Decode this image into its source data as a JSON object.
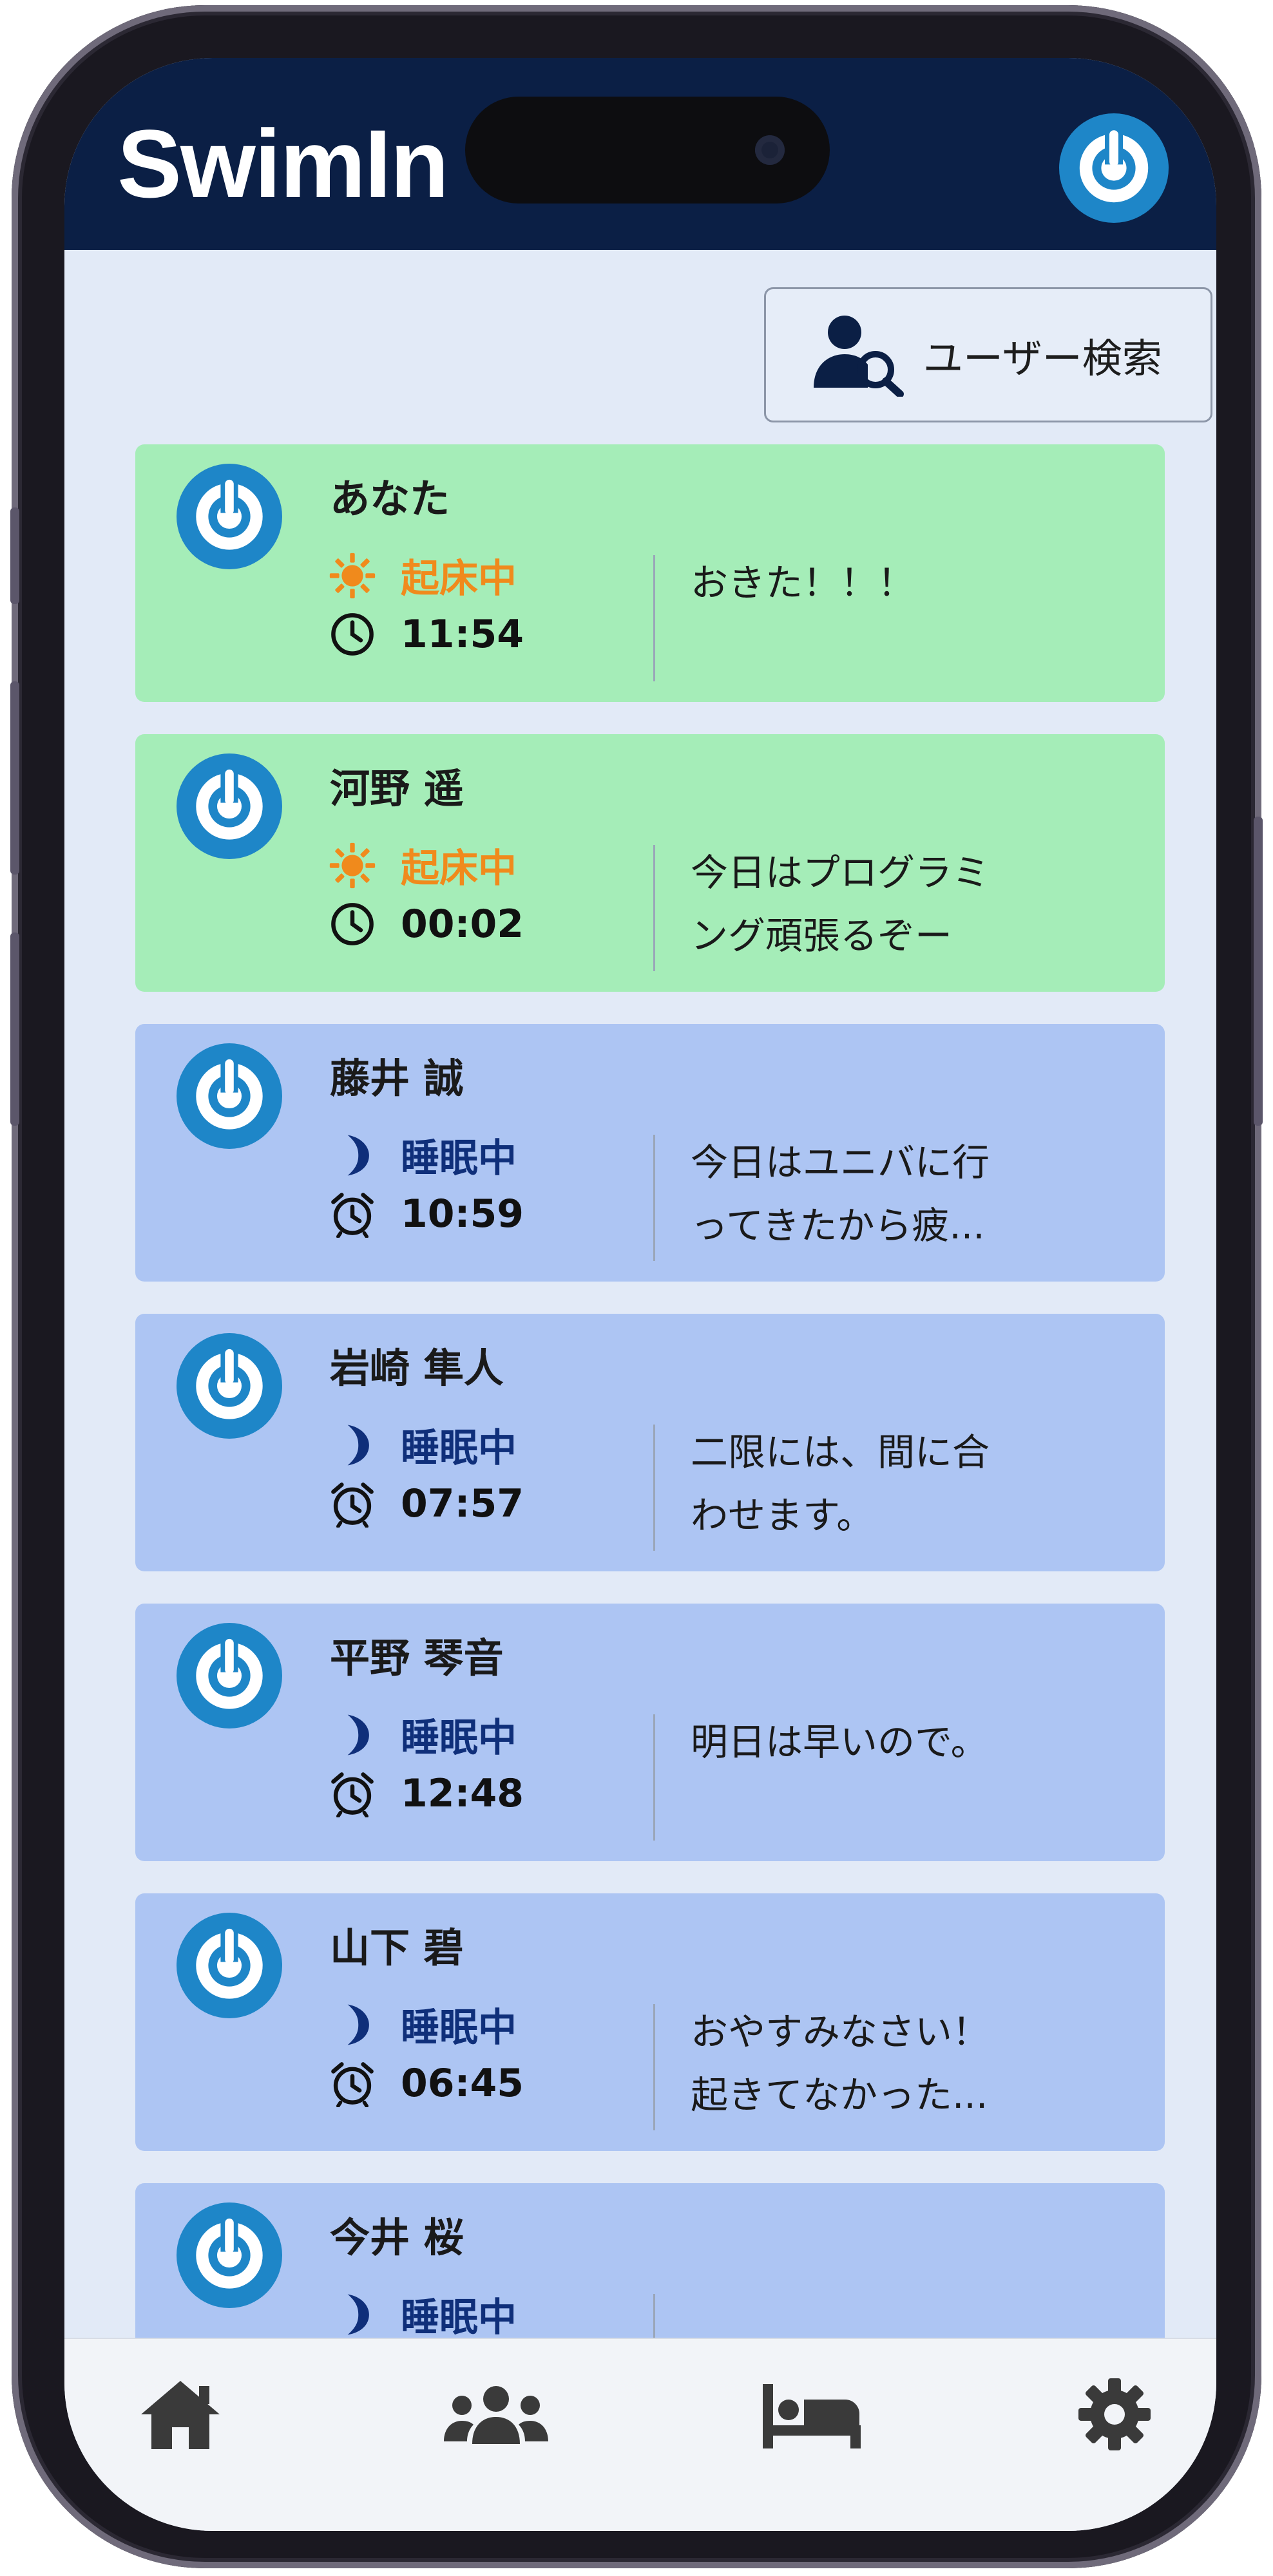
{
  "app": {
    "title": "SwimIn"
  },
  "colors": {
    "header_bg": "#0b1f45",
    "screen_bg": "#e2eaf7",
    "awake_card": "#a5edb8",
    "asleep_card": "#adc5f3",
    "awake_status": "#f08a1c",
    "asleep_status": "#0f2f7a",
    "logo": "#1e86c8"
  },
  "search": {
    "label": "ユーザー検索",
    "icon": "user-search-icon"
  },
  "users": [
    {
      "name": "あなた",
      "state": "awake",
      "status": "起床中",
      "status_icon": "sun-icon",
      "time_icon": "clock-icon",
      "time": "11:54",
      "message": "おきた！！！"
    },
    {
      "name": "河野 遥",
      "state": "awake",
      "status": "起床中",
      "status_icon": "sun-icon",
      "time_icon": "clock-icon",
      "time": "00:02",
      "message": "今日はプログラミ\nング頑張るぞー"
    },
    {
      "name": "藤井 誠",
      "state": "asleep",
      "status": "睡眠中",
      "status_icon": "moon-icon",
      "time_icon": "alarm-clock-icon",
      "time": "10:59",
      "message": "今日はユニバに行\nってきたから疲..."
    },
    {
      "name": "岩崎 隼人",
      "state": "asleep",
      "status": "睡眠中",
      "status_icon": "moon-icon",
      "time_icon": "alarm-clock-icon",
      "time": "07:57",
      "message": "二限には、間に合\nわせます。"
    },
    {
      "name": "平野 琴音",
      "state": "asleep",
      "status": "睡眠中",
      "status_icon": "moon-icon",
      "time_icon": "alarm-clock-icon",
      "time": "12:48",
      "message": "明日は早いので。"
    },
    {
      "name": "山下 碧",
      "state": "asleep",
      "status": "睡眠中",
      "status_icon": "moon-icon",
      "time_icon": "alarm-clock-icon",
      "time": "06:45",
      "message": "おやすみなさい！\n起きてなかった..."
    },
    {
      "name": "今井 桜",
      "state": "asleep",
      "status": "睡眠中",
      "status_icon": "moon-icon",
      "time_icon": "alarm-clock-icon",
      "time": "",
      "message": ""
    }
  ],
  "nav": [
    {
      "icon": "home-icon"
    },
    {
      "icon": "group-icon"
    },
    {
      "icon": "bed-icon"
    },
    {
      "icon": "gear-icon"
    }
  ]
}
